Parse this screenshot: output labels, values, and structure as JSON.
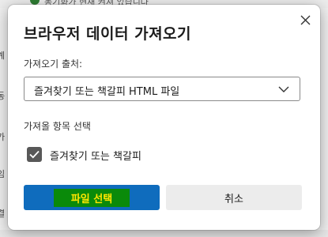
{
  "background": {
    "notice_text": "동기화가 현재 켜져 있습니다",
    "left_fragments": [
      "계",
      "동",
      "가",
      "임",
      "결"
    ]
  },
  "dialog": {
    "title": "브라우저 데이터 가져오기",
    "close_icon": "close-icon",
    "source": {
      "label": "가져오기 출처:",
      "selected": "즐겨찾기 또는 책갈피 HTML 파일"
    },
    "items": {
      "label": "가져올 항목 선택",
      "options": [
        {
          "label": "즐겨찾기 또는 책갈피",
          "checked": true
        }
      ]
    },
    "buttons": {
      "primary_label": "파일 선택",
      "cancel_label": "취소"
    }
  },
  "colors": {
    "accent": "#0f6cbd",
    "highlight_bg": "#0a8a0a",
    "highlight_text": "#ffe600",
    "checkbox": "#585858"
  }
}
